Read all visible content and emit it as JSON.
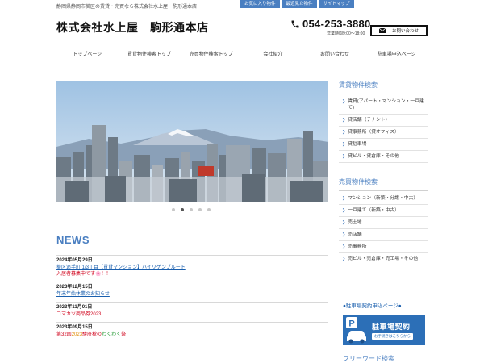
{
  "header": {
    "tagline": "静岡県静岡市葵区の賃貸・売買なら株式会社水上屋　駒形通本店",
    "top_links": [
      "お気に入り物件",
      "最近見た物件",
      "サイトマップ"
    ],
    "company_name": "株式会社水上屋　駒形通本店",
    "phone": "054-253-3880",
    "hours": "営業時間9:00～18:00",
    "contact_label": "お問い合わせ"
  },
  "nav": {
    "items": [
      "トップページ",
      "賃貸物件検索トップ",
      "売買物件検索トップ",
      "会社紹介",
      "お問い合わせ",
      "駐車場申込ページ"
    ]
  },
  "slider": {
    "dot_count": 5,
    "active_dot": 1
  },
  "news": {
    "heading": "NEWS",
    "items": [
      {
        "date": "2024年05月29日",
        "line1": "葵区追手町 1/3丁目【賃貸マンション】ハイリゲンブルート",
        "line2": "入居者募集中です🌸！！"
      },
      {
        "date": "2023年12月15日",
        "title": "年末年始休業のお知らせ"
      },
      {
        "date": "2023年11月01日",
        "title": "コマカツ商品券2023"
      },
      {
        "date": "2023年09月15日",
        "t_part1": "第32回",
        "t_part2": "2023",
        "t_part3": "駿府秋の",
        "t_part4": "わくわく",
        "t_part5": "祭"
      }
    ]
  },
  "sidebar": {
    "rent_heading": "賃貸物件検索",
    "rent_items": [
      "賃貸(アパート・マンション・一戸建て)",
      "貸店舗（テナント）",
      "貸事務所（貸オフィス）",
      "貸駐車場",
      "貸ビル・貸倉庫・その他"
    ],
    "sale_heading": "売買物件検索",
    "sale_items": [
      "マンション（新築・分譲・中古）",
      "一戸建て（新築・中古）",
      "売土地",
      "売店舗",
      "売事務所",
      "売ビル・売倉庫・売工場・その他"
    ],
    "parking_link": "●駐車場契約申込ページ●",
    "parking_banner_title": "駐車場契約",
    "parking_banner_sub": "お手続きはこちらから",
    "freeword_heading": "フリーワード検索"
  },
  "colors": {
    "accent": "#4a7fc1",
    "link": "#1a5fae",
    "banner": "#2c6fb7",
    "news_red": "#d0021b"
  }
}
